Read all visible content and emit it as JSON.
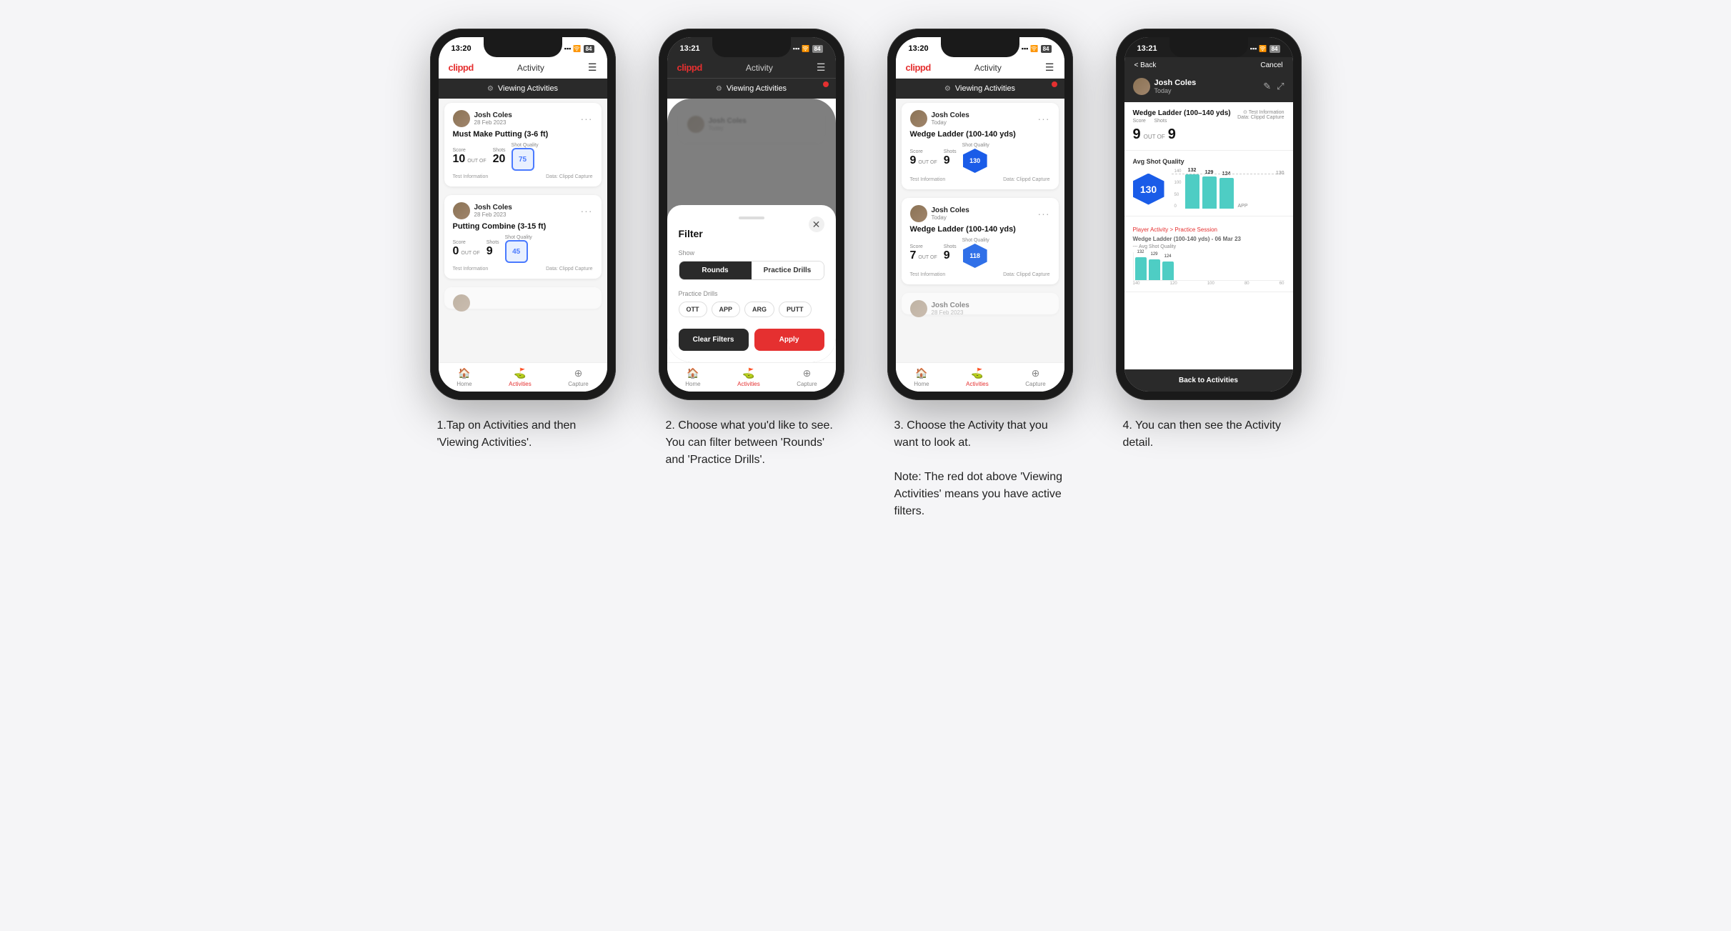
{
  "phones": [
    {
      "id": "phone1",
      "statusTime": "13:20",
      "navLogo": "clippd",
      "navTitle": "Activity",
      "viewingBanner": "Viewing Activities",
      "hasBanner": true,
      "hasRedDot": false,
      "cards": [
        {
          "userName": "Josh Coles",
          "userDate": "28 Feb 2023",
          "title": "Must Make Putting (3-6 ft)",
          "scoreLabel": "Score",
          "shotsLabel": "Shots",
          "shotQualityLabel": "Shot Quality",
          "score": "10",
          "outOf": "OUT OF",
          "shots": "20",
          "shotQuality": "75",
          "sqType": "box",
          "footer1": "Test Information",
          "footer2": "Data: Clippd Capture"
        },
        {
          "userName": "Josh Coles",
          "userDate": "28 Feb 2023",
          "title": "Putting Combine (3-15 ft)",
          "scoreLabel": "Score",
          "shotsLabel": "Shots",
          "shotQualityLabel": "Shot Quality",
          "score": "0",
          "outOf": "OUT OF",
          "shots": "9",
          "shotQuality": "45",
          "sqType": "box",
          "footer1": "Test Information",
          "footer2": "Data: Clippd Capture"
        }
      ],
      "bottomNav": [
        "Home",
        "Activities",
        "Capture"
      ]
    },
    {
      "id": "phone2",
      "statusTime": "13:21",
      "navLogo": "clippd",
      "navTitle": "Activity",
      "viewingBanner": "Viewing Activities",
      "hasBanner": true,
      "hasRedDot": false,
      "filter": {
        "title": "Filter",
        "showLabel": "Show",
        "toggles": [
          "Rounds",
          "Practice Drills"
        ],
        "activeToggle": 0,
        "practiceLabel": "Practice Drills",
        "pills": [
          "OTT",
          "APP",
          "ARG",
          "PUTT"
        ],
        "clearLabel": "Clear Filters",
        "applyLabel": "Apply"
      },
      "cards": [],
      "bottomNav": [
        "Home",
        "Activities",
        "Capture"
      ]
    },
    {
      "id": "phone3",
      "statusTime": "13:20",
      "navLogo": "clippd",
      "navTitle": "Activity",
      "viewingBanner": "Viewing Activities",
      "hasBanner": true,
      "hasRedDot": true,
      "cards": [
        {
          "userName": "Josh Coles",
          "userDate": "Today",
          "title": "Wedge Ladder (100-140 yds)",
          "scoreLabel": "Score",
          "shotsLabel": "Shots",
          "shotQualityLabel": "Shot Quality",
          "score": "9",
          "outOf": "OUT OF",
          "shots": "9",
          "shotQuality": "130",
          "sqType": "hex",
          "footer1": "Test Information",
          "footer2": "Data: Clippd Capture"
        },
        {
          "userName": "Josh Coles",
          "userDate": "Today",
          "title": "Wedge Ladder (100-140 yds)",
          "scoreLabel": "Score",
          "shotsLabel": "Shots",
          "shotQualityLabel": "Shot Quality",
          "score": "7",
          "outOf": "OUT OF",
          "shots": "9",
          "shotQuality": "118",
          "sqType": "hex",
          "hexClass": "blue118",
          "footer1": "Test Information",
          "footer2": "Data: Clippd Capture"
        },
        {
          "userName": "Josh Coles",
          "userDate": "28 Feb 2023",
          "title": "",
          "score": "",
          "shots": "",
          "shotQuality": ""
        }
      ],
      "bottomNav": [
        "Home",
        "Activities",
        "Capture"
      ]
    },
    {
      "id": "phone4",
      "statusTime": "13:21",
      "back": "< Back",
      "cancel": "Cancel",
      "userName": "Josh Coles",
      "userSub": "Today",
      "drillTitle": "Wedge Ladder (100–140 yds)",
      "scoreLabel": "Score",
      "shotsLabel": "Shots",
      "score": "9",
      "outOf": "OUT OF",
      "shots": "9",
      "avgLabel": "Avg Shot Quality",
      "avgValue": "130",
      "chartBars": [
        {
          "value": 132,
          "label": ""
        },
        {
          "value": 129,
          "label": ""
        },
        {
          "value": 124,
          "label": ""
        }
      ],
      "chartYLabels": [
        "140",
        "120",
        "100",
        "80",
        "60"
      ],
      "sessionLinkLabel": "Player Activity > Practice Session",
      "sessionTitle": "Wedge Ladder (100-140 yds) - 06 Mar 23",
      "sessionSubLabel": "--- Avg Shot Quality",
      "backToActivities": "Back to Activities"
    }
  ],
  "captions": [
    "1.Tap on Activities and then 'Viewing Activities'.",
    "2. Choose what you'd like to see. You can filter between 'Rounds' and 'Practice Drills'.",
    "3. Choose the Activity that you want to look at.\n\nNote: The red dot above 'Viewing Activities' means you have active filters.",
    "4. You can then see the Activity detail."
  ]
}
